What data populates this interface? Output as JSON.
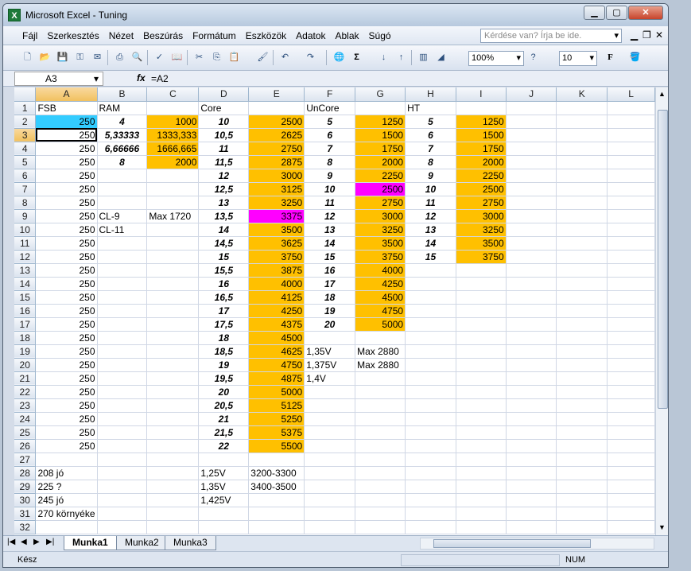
{
  "window": {
    "title": "Microsoft Excel - Tuning",
    "min": "▁",
    "max": "▢",
    "close": "✕"
  },
  "menu": {
    "items": [
      "Fájl",
      "Szerkesztés",
      "Nézet",
      "Beszúrás",
      "Formátum",
      "Eszközök",
      "Adatok",
      "Ablak",
      "Súgó"
    ],
    "help_placeholder": "Kérdése van? Írja be ide.",
    "ctrl_min": "▁",
    "ctrl_restore": "❐",
    "ctrl_close": "✕"
  },
  "toolbar": {
    "zoom": "100%",
    "font_size": "10",
    "sum_icon": "Σ",
    "bold_icon": "F"
  },
  "formula_bar": {
    "cell_ref": "A3",
    "fx": "fx",
    "formula": "=A2"
  },
  "columns": [
    "A",
    "B",
    "C",
    "D",
    "E",
    "F",
    "G",
    "H",
    "I",
    "J",
    "K",
    "L"
  ],
  "rows": [
    {
      "n": "1",
      "A": "FSB",
      "B": "RAM",
      "C": "",
      "D": "Core",
      "E": "",
      "F": "UnCore",
      "G": "",
      "H": "HT",
      "I": ""
    },
    {
      "n": "2",
      "A": "250",
      "B": "4",
      "C": "1000",
      "D": "10",
      "E": "2500",
      "F": "5",
      "G": "1250",
      "H": "5",
      "I": "1250"
    },
    {
      "n": "3",
      "A": "250",
      "B": "5,33333",
      "C": "1333,333",
      "D": "10,5",
      "E": "2625",
      "F": "6",
      "G": "1500",
      "H": "6",
      "I": "1500"
    },
    {
      "n": "4",
      "A": "250",
      "B": "6,66666",
      "C": "1666,665",
      "D": "11",
      "E": "2750",
      "F": "7",
      "G": "1750",
      "H": "7",
      "I": "1750"
    },
    {
      "n": "5",
      "A": "250",
      "B": "8",
      "C": "2000",
      "D": "11,5",
      "E": "2875",
      "F": "8",
      "G": "2000",
      "H": "8",
      "I": "2000"
    },
    {
      "n": "6",
      "A": "250",
      "B": "",
      "C": "",
      "D": "12",
      "E": "3000",
      "F": "9",
      "G": "2250",
      "H": "9",
      "I": "2250"
    },
    {
      "n": "7",
      "A": "250",
      "B": "",
      "C": "",
      "D": "12,5",
      "E": "3125",
      "F": "10",
      "G": "2500",
      "H": "10",
      "I": "2500"
    },
    {
      "n": "8",
      "A": "250",
      "B": "",
      "C": "",
      "D": "13",
      "E": "3250",
      "F": "11",
      "G": "2750",
      "H": "11",
      "I": "2750"
    },
    {
      "n": "9",
      "A": "250",
      "B": "CL-9",
      "C": "Max 1720",
      "D": "13,5",
      "E": "3375",
      "F": "12",
      "G": "3000",
      "H": "12",
      "I": "3000"
    },
    {
      "n": "10",
      "A": "250",
      "B": "CL-11",
      "C": "",
      "D": "14",
      "E": "3500",
      "F": "13",
      "G": "3250",
      "H": "13",
      "I": "3250"
    },
    {
      "n": "11",
      "A": "250",
      "B": "",
      "C": "",
      "D": "14,5",
      "E": "3625",
      "F": "14",
      "G": "3500",
      "H": "14",
      "I": "3500"
    },
    {
      "n": "12",
      "A": "250",
      "B": "",
      "C": "",
      "D": "15",
      "E": "3750",
      "F": "15",
      "G": "3750",
      "H": "15",
      "I": "3750"
    },
    {
      "n": "13",
      "A": "250",
      "B": "",
      "C": "",
      "D": "15,5",
      "E": "3875",
      "F": "16",
      "G": "4000",
      "H": "",
      "I": ""
    },
    {
      "n": "14",
      "A": "250",
      "B": "",
      "C": "",
      "D": "16",
      "E": "4000",
      "F": "17",
      "G": "4250",
      "H": "",
      "I": ""
    },
    {
      "n": "15",
      "A": "250",
      "B": "",
      "C": "",
      "D": "16,5",
      "E": "4125",
      "F": "18",
      "G": "4500",
      "H": "",
      "I": ""
    },
    {
      "n": "16",
      "A": "250",
      "B": "",
      "C": "",
      "D": "17",
      "E": "4250",
      "F": "19",
      "G": "4750",
      "H": "",
      "I": ""
    },
    {
      "n": "17",
      "A": "250",
      "B": "",
      "C": "",
      "D": "17,5",
      "E": "4375",
      "F": "20",
      "G": "5000",
      "H": "",
      "I": ""
    },
    {
      "n": "18",
      "A": "250",
      "B": "",
      "C": "",
      "D": "18",
      "E": "4500",
      "F": "",
      "G": "",
      "H": "",
      "I": ""
    },
    {
      "n": "19",
      "A": "250",
      "B": "",
      "C": "",
      "D": "18,5",
      "E": "4625",
      "F": "1,35V",
      "G": "Max 2880",
      "H": "",
      "I": ""
    },
    {
      "n": "20",
      "A": "250",
      "B": "",
      "C": "",
      "D": "19",
      "E": "4750",
      "F": "1,375V",
      "G": "Max 2880",
      "H": "",
      "I": ""
    },
    {
      "n": "21",
      "A": "250",
      "B": "",
      "C": "",
      "D": "19,5",
      "E": "4875",
      "F": "1,4V",
      "G": "",
      "H": "",
      "I": ""
    },
    {
      "n": "22",
      "A": "250",
      "B": "",
      "C": "",
      "D": "20",
      "E": "5000",
      "F": "",
      "G": "",
      "H": "",
      "I": ""
    },
    {
      "n": "23",
      "A": "250",
      "B": "",
      "C": "",
      "D": "20,5",
      "E": "5125",
      "F": "",
      "G": "",
      "H": "",
      "I": ""
    },
    {
      "n": "24",
      "A": "250",
      "B": "",
      "C": "",
      "D": "21",
      "E": "5250",
      "F": "",
      "G": "",
      "H": "",
      "I": ""
    },
    {
      "n": "25",
      "A": "250",
      "B": "",
      "C": "",
      "D": "21,5",
      "E": "5375",
      "F": "",
      "G": "",
      "H": "",
      "I": ""
    },
    {
      "n": "26",
      "A": "250",
      "B": "",
      "C": "",
      "D": "22",
      "E": "5500",
      "F": "",
      "G": "",
      "H": "",
      "I": ""
    },
    {
      "n": "27",
      "A": "",
      "B": "",
      "C": "",
      "D": "",
      "E": "",
      "F": "",
      "G": "",
      "H": "",
      "I": ""
    },
    {
      "n": "28",
      "A": "208 jó",
      "B": "",
      "C": "",
      "D": "1,25V",
      "E": "3200-3300",
      "F": "",
      "G": "",
      "H": "",
      "I": ""
    },
    {
      "n": "29",
      "A": "225 ?",
      "B": "",
      "C": "",
      "D": "1,35V",
      "E": "3400-3500",
      "F": "",
      "G": "",
      "H": "",
      "I": ""
    },
    {
      "n": "30",
      "A": "245 jó",
      "B": "",
      "C": "",
      "D": "1,425V",
      "E": "",
      "F": "",
      "G": "",
      "H": "",
      "I": ""
    },
    {
      "n": "31",
      "A": "270 környéke",
      "B": "",
      "C": "",
      "D": "",
      "E": "",
      "F": "",
      "G": "",
      "H": "",
      "I": ""
    },
    {
      "n": "32",
      "A": "",
      "B": "",
      "C": "",
      "D": "",
      "E": "",
      "F": "",
      "G": "",
      "H": "",
      "I": ""
    }
  ],
  "sheet_tabs": [
    "Munka1",
    "Munka2",
    "Munka3"
  ],
  "status": {
    "left": "Kész",
    "num": "NUM"
  },
  "colors": {
    "orange": "#ffc000",
    "magenta": "#ff00ff",
    "cyan": "#33ccff"
  }
}
